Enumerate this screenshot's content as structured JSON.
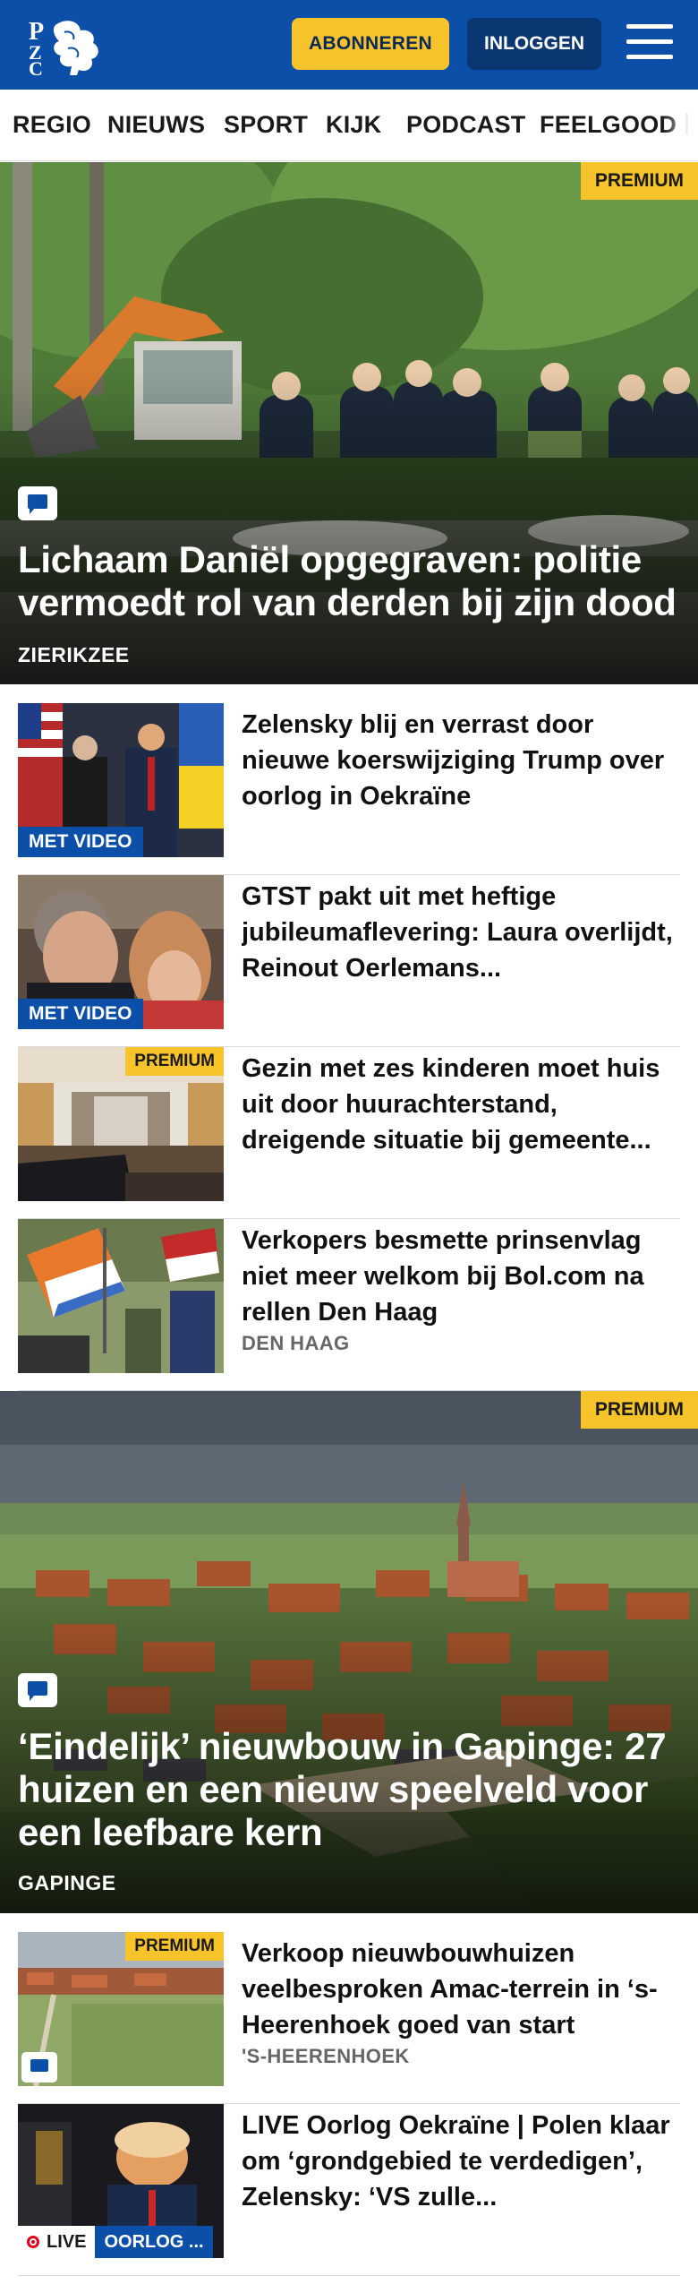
{
  "header": {
    "logo_text": "PZC",
    "subscribe_label": "ABONNEREN",
    "login_label": "INLOGGEN",
    "menu_icon": "hamburger-menu-icon",
    "colors": {
      "brand_blue": "#0b4fa8",
      "accent_yellow": "#f6c32b",
      "login_dark": "#0a3672"
    }
  },
  "nav": {
    "items": [
      "REGIO",
      "NIEUWS",
      "SPORT",
      "KIJK",
      "PODCAST",
      "FEELGOOD"
    ]
  },
  "hero1": {
    "badge": "PREMIUM",
    "title": "Lichaam Daniël opgegraven: politie vermoedt rol van derden bij zijn dood",
    "place": "ZIERIKZEE"
  },
  "articles": [
    {
      "title": "Zelensky blij en verrast door nieuwe koerswijziging Trump over oorlog in Oekraïne",
      "tag": "MET VIDEO"
    },
    {
      "title": "GTST pakt uit met heftige jubileumaflevering: Laura overlijdt, Reinout Oerlemans...",
      "tag": "MET VIDEO"
    },
    {
      "title": "Gezin met zes kinderen moet huis uit door huurachterstand, dreigende situatie bij gemeente...",
      "badge": "PREMIUM"
    },
    {
      "title": "Verkopers besmette prinsenvlag niet meer welkom bij Bol.com na rellen Den Haag",
      "place": "DEN HAAG"
    }
  ],
  "hero2": {
    "badge": "PREMIUM",
    "title": "‘Eindelijk’ nieuwbouw in Gapinge: 27 huizen en een nieuw speelveld voor een leefbare kern",
    "place": "GAPINGE"
  },
  "articles2": [
    {
      "title": "Verkoop nieuwbouwhuizen veelbesproken Amac-terrein in ‘s-Heerenhoek goed van start",
      "badge": "PREMIUM",
      "place": "'S-HEERENHOEK"
    },
    {
      "title": "LIVE Oorlog Oekraïne | Polen klaar om ‘grondgebied te verdedigen’, Zelensky: ‘VS zulle...",
      "live": "LIVE",
      "topic": "OORLOG ..."
    }
  ]
}
